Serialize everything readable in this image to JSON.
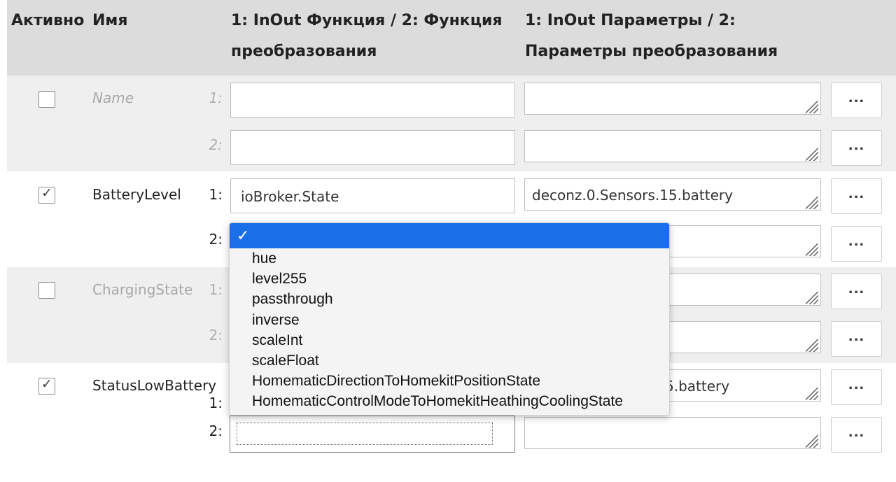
{
  "header": {
    "active": "Активно",
    "name": "Имя",
    "func_line1": "1: InOut Функция / 2: Функция",
    "func_line2": "преобразования",
    "params_line1": "1: InOut Параметры / 2:",
    "params_line2": "Параметры преобразования"
  },
  "rows": [
    {
      "active": false,
      "name": "Name",
      "idx1": "1:",
      "idx2": "2:",
      "func1": "",
      "func2": "",
      "param1": "",
      "param2": "",
      "btn1": "...",
      "btn2": "..."
    },
    {
      "active": true,
      "name": "BatteryLevel",
      "idx1": "1:",
      "idx2": "2:",
      "func1": "ioBroker.State",
      "func2": "",
      "param1": "deconz.0.Sensors.15.battery",
      "param2": "",
      "btn1": "...",
      "btn2": "..."
    },
    {
      "active": false,
      "name": "ChargingState",
      "idx1": "1:",
      "idx2": "2:",
      "func1": "",
      "func2": "",
      "param1": "",
      "param2": "",
      "btn1": "...",
      "btn2": "..."
    },
    {
      "active": true,
      "name": "StatusLowBattery",
      "idx1": "1:",
      "idx2": "2:",
      "func1": "",
      "func2": "",
      "param1": "5.battery",
      "param2": "",
      "btn1": "...",
      "btn2": "..."
    }
  ],
  "dropdown": {
    "selected_mark": "✓",
    "options": [
      "hue",
      "level255",
      "passthrough",
      "inverse",
      "scaleInt",
      "scaleFloat",
      "HomematicDirectionToHomekitPositionState",
      "HomematicControlModeToHomekitHeathingCoolingState"
    ]
  },
  "colors": {
    "header_bg": "#dcdcdc",
    "row_gray_bg": "#efefef",
    "selection": "#1a6fe8"
  }
}
